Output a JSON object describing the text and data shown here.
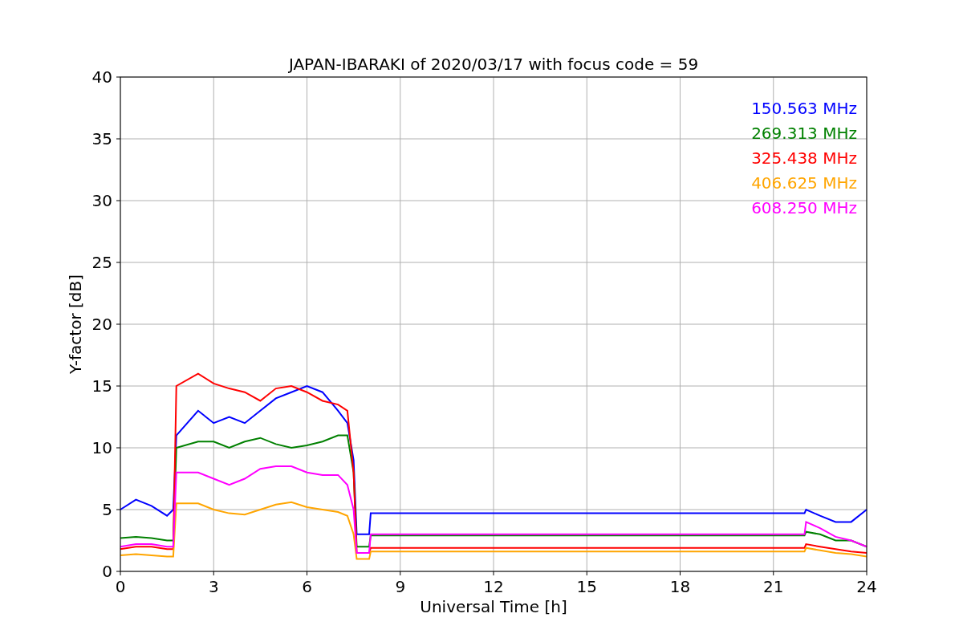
{
  "figure": {
    "chart_data": {
      "type": "line",
      "title": "JAPAN-IBARAKI of 2020/03/17 with focus code = 59",
      "xlabel": "Universal Time [h]",
      "ylabel": "Y-factor [dB]",
      "x": [
        0,
        0.5,
        1,
        1.5,
        1.7,
        1.8,
        2.5,
        3,
        3.5,
        4,
        4.5,
        5,
        5.5,
        6,
        6.5,
        7,
        7.3,
        7.5,
        7.6,
        8,
        8.05,
        22,
        22.05,
        22.5,
        23,
        23.5,
        24
      ],
      "series": [
        {
          "name": "150.563 MHz",
          "color": "#0000ff",
          "values": [
            5,
            5.8,
            5.3,
            4.5,
            5,
            11,
            13,
            12,
            12.5,
            12,
            13,
            14,
            14.5,
            15,
            14.5,
            13,
            12,
            9,
            3,
            3,
            4.7,
            4.7,
            5,
            4.5,
            4,
            4,
            5
          ]
        },
        {
          "name": "269.313 MHz",
          "color": "#008000",
          "values": [
            2.7,
            2.8,
            2.7,
            2.5,
            2.5,
            10,
            10.5,
            10.5,
            10,
            10.5,
            10.8,
            10.3,
            10,
            10.2,
            10.5,
            11,
            11,
            8,
            2,
            2,
            2.9,
            2.9,
            3.2,
            3,
            2.5,
            2.5,
            2
          ]
        },
        {
          "name": "325.438 MHz",
          "color": "#ff0000",
          "values": [
            1.8,
            2,
            2,
            1.8,
            1.8,
            15,
            16,
            15.2,
            14.8,
            14.5,
            13.8,
            14.8,
            15,
            14.5,
            13.8,
            13.5,
            13,
            8,
            1.5,
            1.5,
            1.9,
            1.9,
            2.2,
            2,
            1.8,
            1.6,
            1.5
          ]
        },
        {
          "name": "406.625 MHz",
          "color": "#ffa500",
          "values": [
            1.3,
            1.4,
            1.3,
            1.2,
            1.2,
            5.5,
            5.5,
            5,
            4.7,
            4.6,
            5,
            5.4,
            5.6,
            5.2,
            5,
            4.8,
            4.5,
            3,
            1,
            1,
            1.6,
            1.6,
            1.9,
            1.7,
            1.5,
            1.4,
            1.2
          ]
        },
        {
          "name": "608.250 MHz",
          "color": "#ff00ff",
          "values": [
            2,
            2.2,
            2.2,
            2,
            2,
            8,
            8,
            7.5,
            7,
            7.5,
            8.3,
            8.5,
            8.5,
            8,
            7.8,
            7.8,
            7,
            5,
            1.5,
            1.5,
            3,
            3,
            4,
            3.5,
            2.8,
            2.5,
            2
          ]
        }
      ],
      "grid": true,
      "xlim": [
        0,
        24
      ],
      "ylim": [
        0,
        40
      ],
      "xticks": [
        0,
        3,
        6,
        9,
        12,
        15,
        18,
        21,
        24
      ],
      "yticks": [
        0,
        5,
        10,
        15,
        20,
        25,
        30,
        35,
        40
      ]
    }
  }
}
